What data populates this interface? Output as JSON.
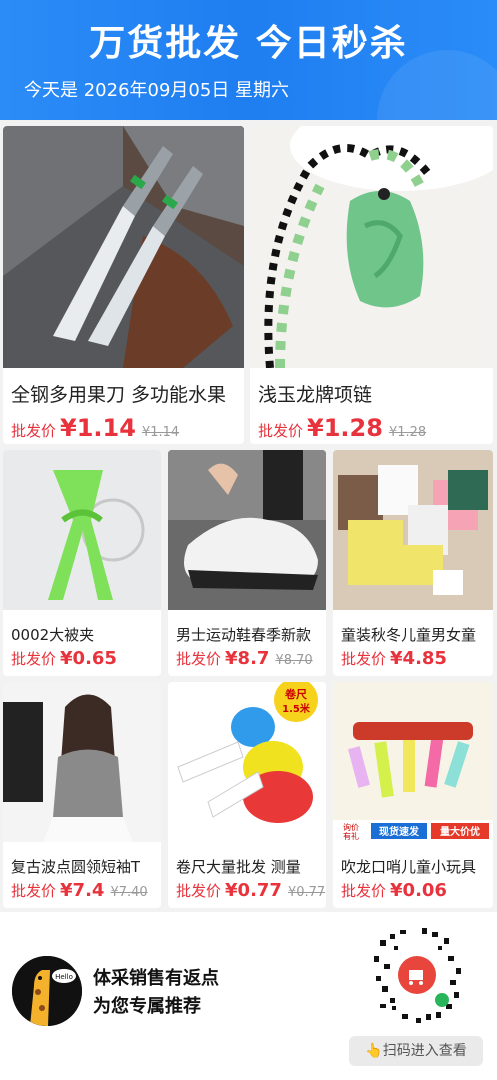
{
  "header": {
    "title": "万货批发 今日秒杀",
    "date_text": "今天是 2026年09月05日 星期六"
  },
  "price_label": "批发价",
  "products": [
    {
      "name": "全钢多用果刀 多功能水果",
      "price": "¥1.14",
      "old_price": "¥1.14"
    },
    {
      "name": "浅玉龙牌项链",
      "price": "¥1.28",
      "old_price": "¥1.28"
    },
    {
      "name": "0002大被夹",
      "price": "¥0.65",
      "old_price": ""
    },
    {
      "name": "男士运动鞋春季新款",
      "price": "¥8.7",
      "old_price": "¥8.70"
    },
    {
      "name": "童装秋冬儿童男女童",
      "price": "¥4.85",
      "old_price": ""
    },
    {
      "name": "复古波点圆领短袖T",
      "price": "¥7.4",
      "old_price": "¥7.40"
    },
    {
      "name": "卷尺大量批发 测量",
      "price": "¥0.77",
      "old_price": "¥0.77"
    },
    {
      "name": "吹龙口哨儿童小玩具",
      "price": "¥0.06",
      "old_price": ""
    }
  ],
  "tape_badge": {
    "line1": "卷尺",
    "line2": "1.5米"
  },
  "banner_tags": {
    "small1": "询价",
    "small2": "有礼",
    "tag1": "现货速发",
    "tag2": "量大价优"
  },
  "giraffe_badge": "Hello",
  "footer": {
    "line1": "体采销售有返点",
    "line2": "为您专属推荐",
    "scan_label": "扫码进入查看"
  },
  "colors": {
    "header_blue": "#1f7ef0",
    "price_red": "#e8323c"
  }
}
